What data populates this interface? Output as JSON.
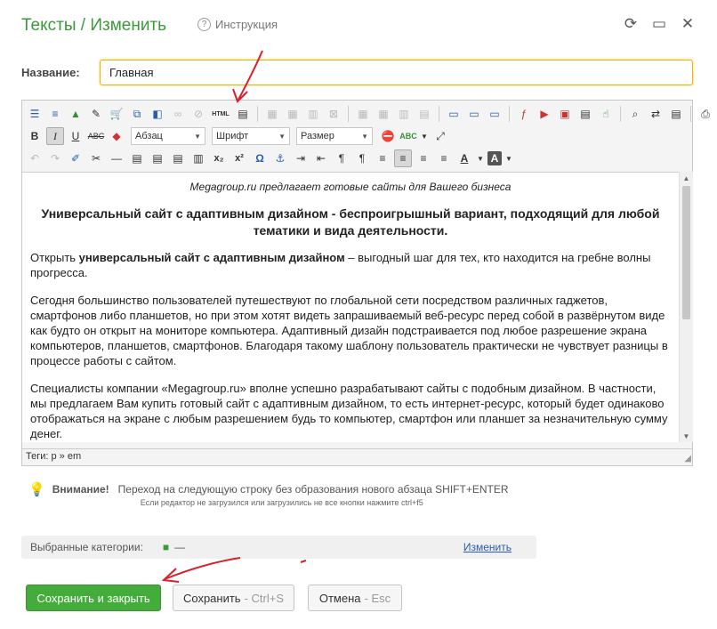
{
  "header": {
    "title": "Тексты / Изменить",
    "help_label": "Инструкция"
  },
  "form": {
    "name_label": "Название:",
    "name_value": "Главная"
  },
  "toolbar": {
    "html_label": "HTML",
    "format_combo": "Абзац",
    "font_combo": "Шрифт",
    "size_combo": "Размер"
  },
  "content": {
    "tagline": "Megagroup.ru предлагает готовые сайты для Вашего бизнеса",
    "heading": "Универсальный сайт с адаптивным дизайном - беспроигрышный вариант, подходящий для любой тематики и вида деятельности.",
    "p1_prefix": "Открыть ",
    "p1_bold": "универсальный сайт с адаптивным дизайном",
    "p1_rest": " – выгодный шаг для тех, кто находится на гребне волны прогресса.",
    "p2": "Сегодня большинство пользователей путешествуют по глобальной сети посредством различных гаджетов, смартфонов либо планшетов, но при этом хотят видеть запрашиваемый веб-ресурс перед собой в развёрнутом виде как будто он открыт на мониторе компьютера. Адаптивный дизайн подстраивается под любое разрешение экрана компьютеров, планшетов, смартфонов. Благодаря такому шаблону пользователь практически не чувствует разницы в процессе работы с сайтом.",
    "p3": "Специалисты компании «Megagroup.ru» вполне успешно разрабатывают сайты с подобным дизайном. В частности, мы предлагаем Вам купить готовый сайт с адаптивным дизайном, то есть интернет-ресурс, который будет одинаково отображаться на экране с любым разрешением будь то компьютер, смартфон или планшет за незначительную сумму денег."
  },
  "statusbar": {
    "tags": "Теги: p » em"
  },
  "notice": {
    "label": "Внимание!",
    "text": "Переход на следующую строку без образования нового абзаца SHIFT+ENTER",
    "sub": "Если редактор не загрузился или загрузились не все кнопки нажмите ctrl+f5"
  },
  "categories": {
    "label": "Выбранные категории:",
    "value": "—",
    "change_link": "Изменить"
  },
  "buttons": {
    "save_close": "Сохранить и закрыть",
    "save": "Сохранить",
    "save_kbd": "- Ctrl+S",
    "cancel": "Отмена",
    "cancel_kbd": "- Esc"
  },
  "colors": {
    "accent": "#3a9a3a",
    "primary_button": "#44ac3a",
    "input_border": "#f0b400",
    "link": "#2a5db0",
    "annotation_arrow": "#d9202a"
  }
}
